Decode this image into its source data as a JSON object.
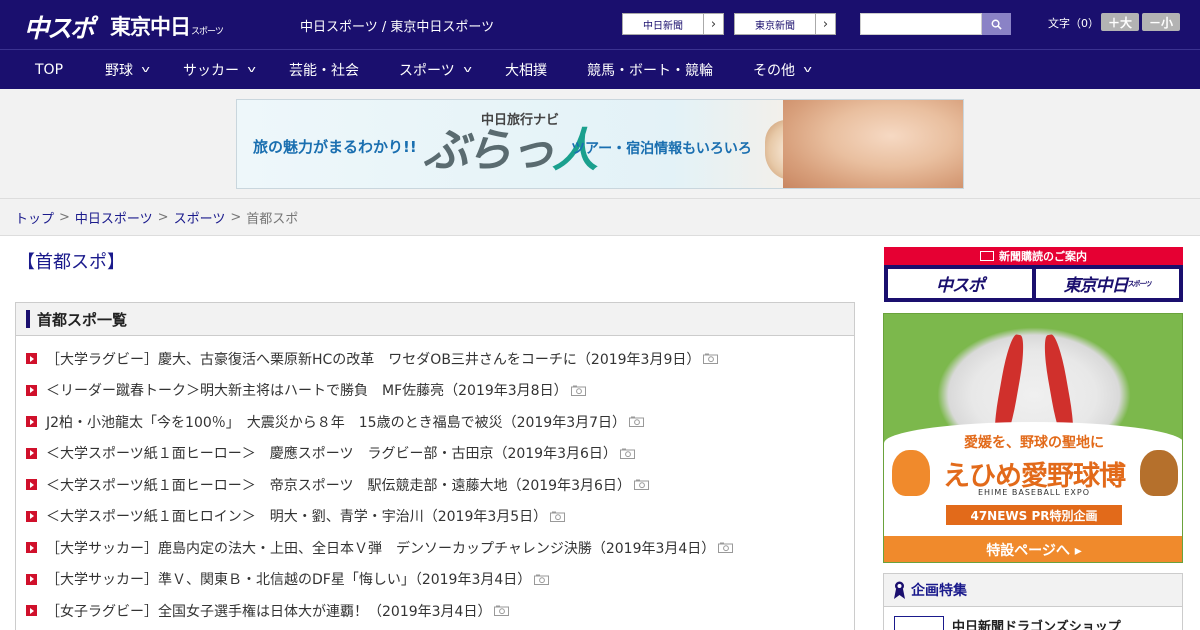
{
  "header": {
    "logo_chuspo": "中スポ",
    "logo_tokyo": "東京中日",
    "logo_tokyo_suffix": "スポーツ",
    "site_title": "中日スポーツ / 東京中日スポーツ",
    "chunichi_button": "中日新聞",
    "tokyo_button": "東京新聞",
    "search_placeholder": "",
    "font_size_label": "文字（0）",
    "size_up": "＋大",
    "size_down": "－小"
  },
  "nav": {
    "items": [
      {
        "label": "TOP",
        "has_dropdown": false
      },
      {
        "label": "野球",
        "has_dropdown": true
      },
      {
        "label": "サッカー",
        "has_dropdown": true
      },
      {
        "label": "芸能・社会",
        "has_dropdown": false
      },
      {
        "label": "スポーツ",
        "has_dropdown": true
      },
      {
        "label": "大相撲",
        "has_dropdown": false
      },
      {
        "label": "競馬・ボート・競輪",
        "has_dropdown": false
      },
      {
        "label": "その他",
        "has_dropdown": true
      }
    ]
  },
  "banner": {
    "left_text": "旅の魅力がまるわかり!!",
    "navi_label": "中日旅行ナビ",
    "logo_a": "ぶらっ",
    "logo_b": "人",
    "right_text": "ツアー・宿泊情報もいろいろ"
  },
  "breadcrumb": {
    "items": [
      "トップ",
      "中日スポーツ",
      "スポーツ"
    ],
    "current": "首都スポ",
    "separator": ">"
  },
  "page": {
    "title": "【首都スポ】",
    "list_heading": "首都スポ一覧"
  },
  "articles": [
    {
      "text": "［大学ラグビー］慶大、古豪復活へ栗原新HCの改革　ワセダOB三井さんをコーチに（2019年3月9日）",
      "has_photo": true
    },
    {
      "text": "＜リーダー蹴春トーク＞明大新主将はハートで勝負　MF佐藤亮（2019年3月8日）",
      "has_photo": true
    },
    {
      "text": "J2柏・小池龍太「今を100％」　大震災から８年　15歳のとき福島で被災（2019年3月7日）",
      "has_photo": true
    },
    {
      "text": "＜大学スポーツ紙１面ヒーロー＞　慶應スポーツ　ラグビー部・古田京（2019年3月6日）",
      "has_photo": true
    },
    {
      "text": "＜大学スポーツ紙１面ヒーロー＞　帝京スポーツ　駅伝競走部・遠藤大地（2019年3月6日）",
      "has_photo": true
    },
    {
      "text": "＜大学スポーツ紙１面ヒロイン＞　明大・劉、青学・宇治川（2019年3月5日）",
      "has_photo": true
    },
    {
      "text": "［大学サッカー］鹿島内定の法大・上田、全日本Ｖ弾　デンソーカップチャレンジ決勝（2019年3月4日）",
      "has_photo": true
    },
    {
      "text": "［大学サッカー］準Ｖ、関東Ｂ・北信越のDF星「悔しい」（2019年3月4日）",
      "has_photo": true
    },
    {
      "text": "［女子ラグビー］全国女子選手権は日体大が連覇！（2019年3月4日）",
      "has_photo": true
    }
  ],
  "sidebar": {
    "subscription_heading": "新聞購読のご案内",
    "sub_logo_1": "中スポ",
    "sub_logo_2": "東京中日",
    "sub_logo_2_suffix": "スポーツ",
    "ad": {
      "line1": "愛媛を、野球の聖地に",
      "line2": "えひめ愛野球博",
      "line3": "EHIME BASEBALL EXPO",
      "line4": "47NEWS PR特別企画",
      "cta": "特設ページへ ▸"
    },
    "feature_heading": "企画特集",
    "feature_item": "中日新聞ドラゴンズショップ"
  },
  "colors": {
    "brand_navy": "#1a0f6e",
    "accent_red": "#d0102b",
    "link_blue": "#1a1a8c",
    "ad_orange": "#e26a1a"
  }
}
